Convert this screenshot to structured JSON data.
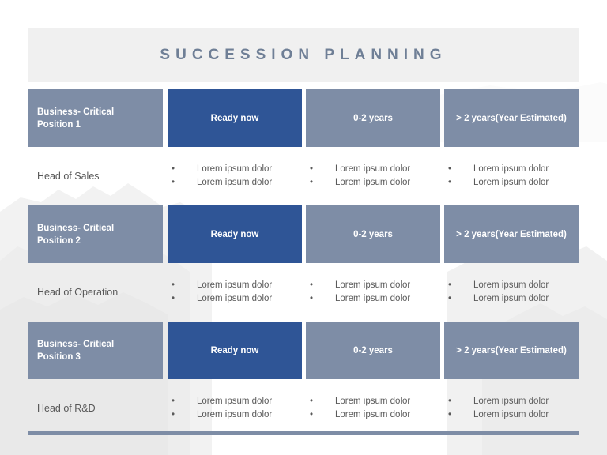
{
  "slide": {
    "title": "SUCCESSION PLANNING",
    "colors": {
      "title_text": "#6f7f96",
      "title_band": "#f0f0f0",
      "header_grey": "#7e8da6",
      "header_blue": "#2f5596",
      "body_text": "#5a5a5a",
      "bottom_bar": "#7e8da6",
      "page_background": "#ffffff"
    }
  },
  "table": {
    "column_headers": {
      "position": "Business- Critical Position",
      "ready": "Ready now",
      "short_term": "0-2 years",
      "long_term": "> 2 years(Year Estimated)"
    },
    "rows": [
      {
        "header": {
          "position_line1": "Business- Critical",
          "position_line2": "Position 1",
          "ready": "Ready now",
          "short_term": "0-2 years",
          "long_term": "> 2 years(Year Estimated)"
        },
        "body": {
          "role": "Head of Sales",
          "ready_bullets": [
            "Lorem ipsum  dolor",
            "Lorem ipsum  dolor"
          ],
          "short_term_bullets": [
            "Lorem ipsum  dolor",
            "Lorem ipsum  dolor"
          ],
          "long_term_bullets": [
            "Lorem ipsum  dolor",
            "Lorem ipsum  dolor"
          ]
        }
      },
      {
        "header": {
          "position_line1": "Business- Critical",
          "position_line2": "Position 2",
          "ready": "Ready now",
          "short_term": "0-2 years",
          "long_term": "> 2 years(Year Estimated)"
        },
        "body": {
          "role": "Head of Operation",
          "ready_bullets": [
            "Lorem ipsum  dolor",
            "Lorem ipsum  dolor"
          ],
          "short_term_bullets": [
            "Lorem ipsum  dolor",
            "Lorem ipsum  dolor"
          ],
          "long_term_bullets": [
            "Lorem ipsum  dolor",
            "Lorem ipsum  dolor"
          ]
        }
      },
      {
        "header": {
          "position_line1": "Business- Critical",
          "position_line2": "Position 3",
          "ready": "Ready now",
          "short_term": "0-2 years",
          "long_term": "> 2 years(Year Estimated)"
        },
        "body": {
          "role": "Head of R&D",
          "ready_bullets": [
            "Lorem ipsum  dolor",
            "Lorem ipsum  dolor"
          ],
          "short_term_bullets": [
            "Lorem ipsum  dolor",
            "Lorem ipsum  dolor"
          ],
          "long_term_bullets": [
            "Lorem ipsum  dolor",
            "Lorem ipsum  dolor"
          ]
        }
      }
    ]
  },
  "bullet_glyph": "•"
}
